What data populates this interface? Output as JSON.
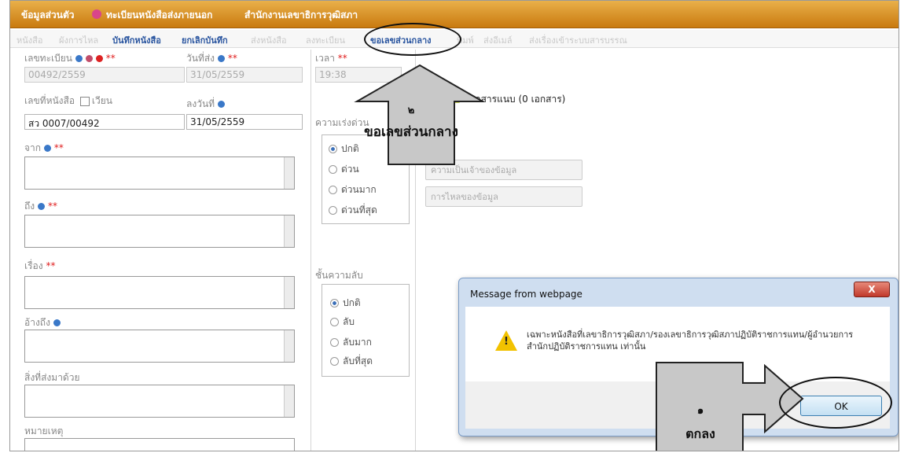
{
  "header": {
    "items": [
      "ข้อมูลส่วนตัว",
      "ทะเบียนหนังสือส่งภายนอก",
      "สำนักงานเลขาธิการวุฒิสภา"
    ]
  },
  "tabs": [
    {
      "label": "หนังสือ",
      "active": false
    },
    {
      "label": "ผังการไหล",
      "active": false
    },
    {
      "label": "บันทึกหนังสือ",
      "active": true
    },
    {
      "label": "ยกเลิกบันทึก",
      "active": true
    },
    {
      "label": "ส่งหนังสือ",
      "active": false
    },
    {
      "label": "ลงทะเบียน",
      "active": false
    },
    {
      "label": "ขอเลขส่วนกลาง",
      "active": true
    },
    {
      "label": "พิมพ์",
      "active": false
    },
    {
      "label": "ส่งอีเมล์",
      "active": false
    },
    {
      "label": "ส่งเรื่องเข้าระบบสารบรรณ",
      "active": false
    }
  ],
  "form": {
    "reg_no_label": "เลขทะเบียน",
    "reg_no_value": "00492/2559",
    "send_date_label": "วันที่ส่ง",
    "send_date_value": "31/05/2559",
    "time_label": "เวลา",
    "time_value": "19:38",
    "doc_no_label": "เลขที่หนังสือ",
    "circular_label": "เวียน",
    "doc_date_label": "ลงวันที่",
    "doc_no_value": "สว 0007/00492",
    "doc_date_value": "31/05/2559",
    "from_label": "จาก",
    "to_label": "ถึง",
    "subject_label": "เรื่อง",
    "reference_label": "อ้างถึง",
    "enclosure_label": "สิ่งที่ส่งมาด้วย",
    "remark_label": "หมายเหตุ",
    "required_marker": "**",
    "urgency_label": "ความเร่งด่วน",
    "urgency_options": [
      "ปกติ",
      "ด่วน",
      "ด่วนมาก",
      "ด่วนที่สุด"
    ],
    "urgency_selected": "ปกติ",
    "secrecy_label": "ชั้นความลับ",
    "secrecy_options": [
      "ปกติ",
      "ลับ",
      "ลับมาก",
      "ลับที่สุด"
    ],
    "secrecy_selected": "ปกติ",
    "attachment_label": "เอกสารแนบ (0 เอกสาร)",
    "btn_owner": "ความเป็นเจ้าของข้อมูล",
    "btn_flow": "การไหลของข้อมูล"
  },
  "callouts": {
    "step2_number": "๒",
    "step2_text": "ขอเลขส่วนกลาง",
    "step1_number": "๑",
    "step1_text": "ตกลง"
  },
  "dialog": {
    "title": "Message from webpage",
    "close_label": "X",
    "message": "เฉพาะหนังสือที่เลขาธิการวุฒิสภา/รองเลขาธิการวุฒิสภาปฏิบัติราชการแทน/ผู้อำนวยการสำนักปฏิบัติราชการแทน เท่านั้น",
    "ok_label": "OK"
  }
}
